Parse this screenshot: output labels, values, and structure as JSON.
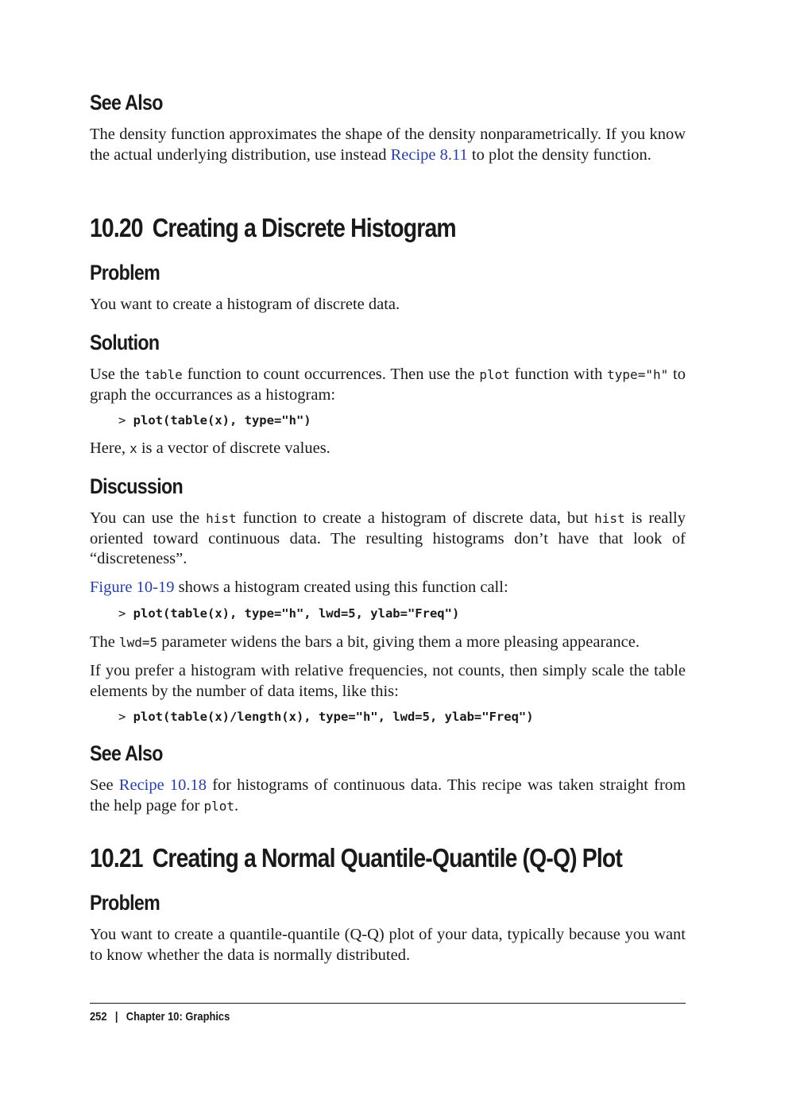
{
  "see_also_1": {
    "heading": "See Also",
    "text_before": "The density function approximates the shape of the density nonparametrically. If you know the actual underlying distribution, use instead ",
    "link": "Recipe 8.11",
    "text_after": " to plot the density function."
  },
  "section_10_20": {
    "number": "10.20",
    "title": "Creating a Discrete Histogram",
    "problem": {
      "heading": "Problem",
      "text": "You want to create a histogram of discrete data."
    },
    "solution": {
      "heading": "Solution",
      "t1": "Use the ",
      "c1": "table",
      "t2": " function to count occurrences. Then use the ",
      "c2": "plot",
      "t3": " function with ",
      "c3": "type=\"h\"",
      "t4": " to graph the occurrances as a histogram:",
      "code_prompt": "> ",
      "code": "plot(table(x), type=\"h\")",
      "here_t1": "Here, ",
      "here_c1": "x",
      "here_t2": " is a vector of discrete values."
    },
    "discussion": {
      "heading": "Discussion",
      "p1_t1": "You can use the ",
      "p1_c1": "hist",
      "p1_t2": " function to create a histogram of discrete data, but ",
      "p1_c2": "hist",
      "p1_t3": " is really oriented toward continuous data. The resulting histograms don’t have that look of “discreteness”.",
      "p2_link": "Figure 10-19",
      "p2_text": " shows a histogram created using this function call:",
      "code1_prompt": "> ",
      "code1": "plot(table(x), type=\"h\", lwd=5, ylab=\"Freq\")",
      "p3_t1": "The ",
      "p3_c1": "lwd=5",
      "p3_t2": " parameter widens the bars a bit, giving them a more pleasing appearance.",
      "p4": "If you prefer a histogram with relative frequencies, not counts, then simply scale the table elements by the number of data items, like this:",
      "code2_prompt": "> ",
      "code2": "plot(table(x)/length(x), type=\"h\", lwd=5, ylab=\"Freq\")"
    },
    "see_also": {
      "heading": "See Also",
      "t1": "See ",
      "link": "Recipe 10.18",
      "t2": " for histograms of continuous data. This recipe was taken straight from the help page for ",
      "c1": "plot",
      "t3": "."
    }
  },
  "section_10_21": {
    "number": "10.21",
    "title": "Creating a Normal Quantile-Quantile (Q-Q) Plot",
    "problem": {
      "heading": "Problem",
      "text": "You want to create a quantile-quantile (Q-Q) plot of your data, typically because you want to know whether the data is normally distributed."
    }
  },
  "footer": {
    "page_number": "252",
    "separator": "|",
    "chapter": "Chapter 10:  Graphics"
  },
  "colors": {
    "link": "#2a3f9d",
    "text": "#1a1a1a"
  }
}
